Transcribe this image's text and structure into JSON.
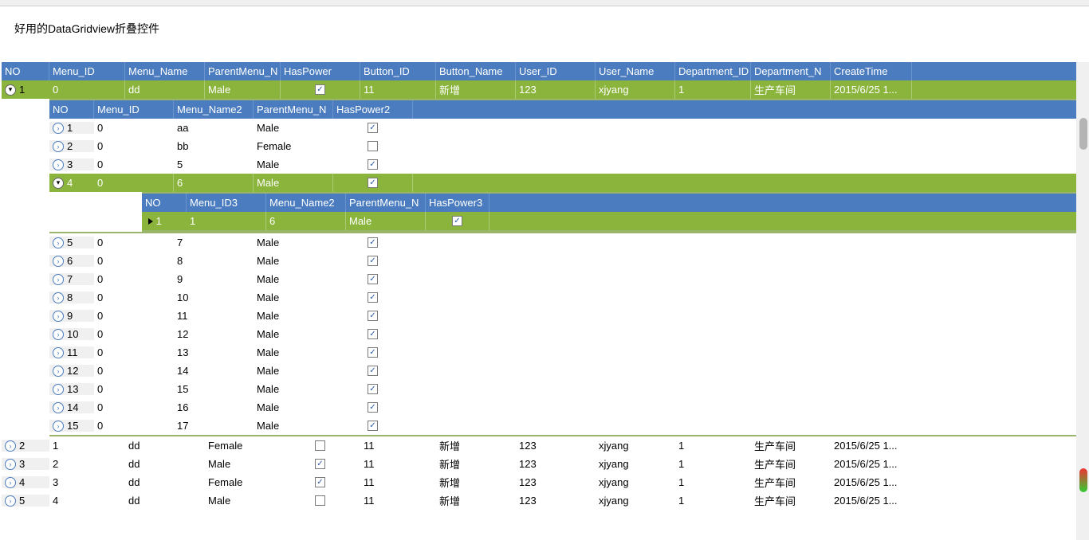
{
  "title": "好用的DataGridview折叠控件",
  "mainHeaders": [
    "NO",
    "Menu_ID",
    "Menu_Name",
    "ParentMenu_N",
    "HasPower",
    "Button_ID",
    "Button_Name",
    "User_ID",
    "User_Name",
    "Department_ID",
    "Department_N",
    "CreateTime"
  ],
  "mainWidths": [
    60,
    95,
    100,
    95,
    100,
    95,
    100,
    100,
    100,
    95,
    100,
    102
  ],
  "mainRows": [
    {
      "no": "1",
      "cells": [
        "0",
        "dd",
        "Male",
        "chk-on",
        "11",
        "新增",
        "123",
        "xjyang",
        "1",
        "生产车间",
        "2015/6/25 1..."
      ],
      "expanded": true,
      "selected": true
    }
  ],
  "subHeaders": [
    "NO",
    "Menu_ID",
    "Menu_Name2",
    "ParentMenu_N",
    "HasPower2"
  ],
  "subWidths": [
    56,
    100,
    100,
    100,
    100
  ],
  "subRows": [
    {
      "no": "1",
      "cells": [
        "0",
        "aa",
        "Male",
        "chk-on"
      ],
      "selected": false
    },
    {
      "no": "2",
      "cells": [
        "0",
        "bb",
        "Female",
        "chk-off"
      ],
      "selected": false
    },
    {
      "no": "3",
      "cells": [
        "0",
        "5",
        "Male",
        "chk-on"
      ],
      "selected": false
    },
    {
      "no": "4",
      "cells": [
        "0",
        "6",
        "Male",
        "chk-on"
      ],
      "selected": true,
      "expanded": true
    }
  ],
  "sub3Headers": [
    "NO",
    "Menu_ID3",
    "Menu_Name2",
    "ParentMenu_N",
    "HasPower3"
  ],
  "sub3Widths": [
    56,
    100,
    100,
    100,
    80
  ],
  "sub3Rows": [
    {
      "no": "1",
      "cells": [
        "1",
        "6",
        "Male",
        "chk-on"
      ],
      "selected": true
    }
  ],
  "subRows2": [
    {
      "no": "5",
      "cells": [
        "0",
        "7",
        "Male",
        "chk-on"
      ]
    },
    {
      "no": "6",
      "cells": [
        "0",
        "8",
        "Male",
        "chk-on"
      ]
    },
    {
      "no": "7",
      "cells": [
        "0",
        "9",
        "Male",
        "chk-on"
      ]
    },
    {
      "no": "8",
      "cells": [
        "0",
        "10",
        "Male",
        "chk-on"
      ]
    },
    {
      "no": "9",
      "cells": [
        "0",
        "11",
        "Male",
        "chk-on"
      ]
    },
    {
      "no": "10",
      "cells": [
        "0",
        "12",
        "Male",
        "chk-on"
      ]
    },
    {
      "no": "11",
      "cells": [
        "0",
        "13",
        "Male",
        "chk-on"
      ]
    },
    {
      "no": "12",
      "cells": [
        "0",
        "14",
        "Male",
        "chk-on"
      ]
    },
    {
      "no": "13",
      "cells": [
        "0",
        "15",
        "Male",
        "chk-on"
      ]
    },
    {
      "no": "14",
      "cells": [
        "0",
        "16",
        "Male",
        "chk-on"
      ]
    },
    {
      "no": "15",
      "cells": [
        "0",
        "17",
        "Male",
        "chk-on"
      ]
    }
  ],
  "mainRows2": [
    {
      "no": "2",
      "cells": [
        "1",
        "dd",
        "Female",
        "chk-off",
        "11",
        "新增",
        "123",
        "xjyang",
        "1",
        "生产车间",
        "2015/6/25 1..."
      ]
    },
    {
      "no": "3",
      "cells": [
        "2",
        "dd",
        "Male",
        "chk-on",
        "11",
        "新增",
        "123",
        "xjyang",
        "1",
        "生产车间",
        "2015/6/25 1..."
      ]
    },
    {
      "no": "4",
      "cells": [
        "3",
        "dd",
        "Female",
        "chk-on",
        "11",
        "新增",
        "123",
        "xjyang",
        "1",
        "生产车间",
        "2015/6/25 1..."
      ]
    },
    {
      "no": "5",
      "cells": [
        "4",
        "dd",
        "Male",
        "chk-off",
        "11",
        "新增",
        "123",
        "xjyang",
        "1",
        "生产车间",
        "2015/6/25 1..."
      ]
    }
  ]
}
